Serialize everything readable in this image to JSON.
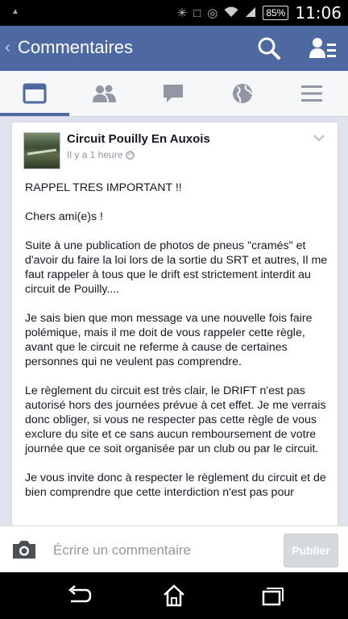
{
  "status_bar": {
    "battery": "85%",
    "time": "11:06"
  },
  "header": {
    "title": "Commentaires",
    "back_icon": "chevron-left-icon",
    "search_icon": "search-icon",
    "friends_icon": "friend-list-icon"
  },
  "tabs": [
    {
      "name": "news-feed",
      "icon": "news-feed-icon",
      "active": true
    },
    {
      "name": "friend-requests",
      "icon": "people-icon",
      "active": false
    },
    {
      "name": "messages",
      "icon": "chat-bubble-icon",
      "active": false
    },
    {
      "name": "notifications",
      "icon": "globe-icon",
      "active": false
    },
    {
      "name": "more",
      "icon": "menu-icon",
      "active": false
    }
  ],
  "post": {
    "page_name": "Circuit Pouilly En Auxois",
    "time": "Il y a 1 heure",
    "paragraphs": [
      "RAPPEL TRES IMPORTANT !!",
      "Chers ami(e)s !",
      "Suite à une publication de photos de pneus \"cramés\" et d'avoir du faire la loi lors de la sortie du SRT et autres, Il me faut rappeler à tous que le drift est strictement interdit au circuit de Pouilly....",
      "Je sais bien que mon message va une nouvelle fois faire polémique, mais il me doit de vous rappeler cette règle, avant que le circuit ne referme à cause de certaines personnes qui ne veulent pas comprendre.",
      "Le règlement du circuit est très clair, le DRIFT n'est pas autorisé hors des journées prévue à cet effet. Je me verrais donc obliger, si vous ne respecter pas cette règle de vous exclure du site et ce sans aucun remboursement de votre journée que ce soit organisée par un club ou par le circuit.",
      "Je vous invite donc à respecter le règlement du circuit et de bien comprendre que cette interdiction n'est pas pour"
    ]
  },
  "comment_bar": {
    "placeholder": "Écrire un commentaire",
    "publish_label": "Publier"
  },
  "colors": {
    "brand": "#4e69a2",
    "feed_bg": "#dfe3ee",
    "text": "#141823",
    "muted": "#9197a3"
  }
}
